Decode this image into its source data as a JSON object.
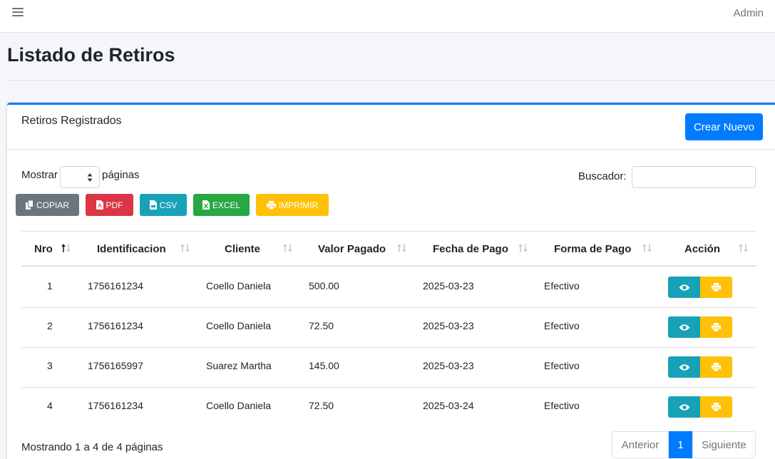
{
  "topbar": {
    "user": "Admin"
  },
  "page": {
    "title": "Listado de Retiros"
  },
  "card": {
    "title": "Retiros Registrados",
    "create_button": "Crear Nuevo"
  },
  "controls": {
    "show_label": "Mostrar",
    "pages_label": "páginas",
    "search_label": "Buscador:",
    "search_value": ""
  },
  "export_buttons": [
    {
      "label": "COPIAR",
      "icon": "copy-icon",
      "color": "#6c757d"
    },
    {
      "label": "PDF",
      "icon": "pdf-file-icon",
      "color": "#dc3545"
    },
    {
      "label": "CSV",
      "icon": "csv-file-icon",
      "color": "#17a2b8"
    },
    {
      "label": "EXCEL",
      "icon": "excel-file-icon",
      "color": "#28a745"
    },
    {
      "label": "IMPRIMIR",
      "icon": "printer-icon",
      "color": "#ffc107"
    }
  ],
  "table": {
    "headers": [
      "Nro",
      "Identificacion",
      "Cliente",
      "Valor Pagado",
      "Fecha de Pago",
      "Forma de Pago",
      "Acción"
    ],
    "sorted_column": "Nro",
    "rows": [
      {
        "nro": "1",
        "identificacion": "1756161234",
        "cliente": "Coello Daniela",
        "valor": "500.00",
        "fecha": "2025-03-23",
        "forma": "Efectivo"
      },
      {
        "nro": "2",
        "identificacion": "1756161234",
        "cliente": "Coello Daniela",
        "valor": "72.50",
        "fecha": "2025-03-23",
        "forma": "Efectivo"
      },
      {
        "nro": "3",
        "identificacion": "1756165997",
        "cliente": "Suarez Martha",
        "valor": "145.00",
        "fecha": "2025-03-23",
        "forma": "Efectivo"
      },
      {
        "nro": "4",
        "identificacion": "1756161234",
        "cliente": "Coello Daniela",
        "valor": "72.50",
        "fecha": "2025-03-24",
        "forma": "Efectivo"
      }
    ],
    "action_icons": [
      "eye-icon",
      "printer-icon"
    ]
  },
  "footer": {
    "info": "Mostrando 1 a 4 de 4 páginas",
    "pagination": {
      "prev": "Anterior",
      "current": "1",
      "next": "Siguiente"
    }
  },
  "colors": {
    "primary": "#007bff",
    "info": "#17a2b8",
    "warning": "#ffc107",
    "danger": "#dc3545",
    "success": "#28a745",
    "secondary": "#6c757d"
  }
}
